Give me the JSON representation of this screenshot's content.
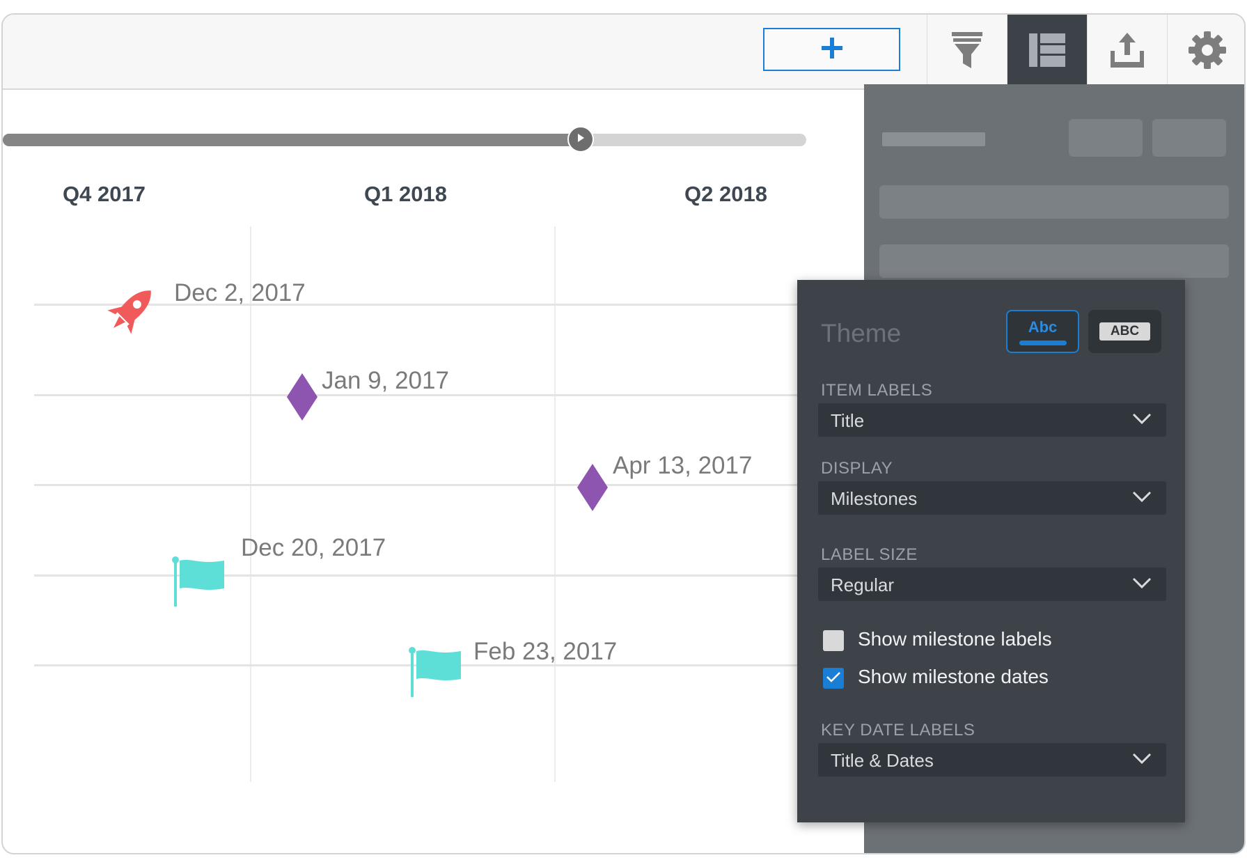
{
  "toolbar": {
    "add_icon": "plus-icon",
    "tools": [
      {
        "name": "filter",
        "icon": "funnel-icon"
      },
      {
        "name": "layout",
        "icon": "layout-icon",
        "active": true
      },
      {
        "name": "export",
        "icon": "upload-icon"
      },
      {
        "name": "settings",
        "icon": "gear-icon"
      }
    ]
  },
  "timeline": {
    "quarters": [
      "Q4 2017",
      "Q1 2018",
      "Q2 2018"
    ],
    "slider_progress": 0.72,
    "milestones": [
      {
        "label": "Dec 2, 2017",
        "icon": "rocket-icon",
        "color": "#f15a5a"
      },
      {
        "label": "Jan 9, 2017",
        "icon": "diamond-icon",
        "color": "#8e55b0"
      },
      {
        "label": "Apr 13, 2017",
        "icon": "diamond-icon",
        "color": "#8e55b0"
      },
      {
        "label": "Dec 20, 2017",
        "icon": "flag-icon",
        "color": "#5ddfd8"
      },
      {
        "label": "Feb 23, 2017",
        "icon": "flag-icon",
        "color": "#5ddfd8"
      }
    ]
  },
  "settings_popup": {
    "theme_title": "Theme",
    "theme_options": [
      "Abc",
      "ABC"
    ],
    "item_labels": {
      "label": "ITEM LABELS",
      "value": "Title"
    },
    "display": {
      "label": "DISPLAY",
      "value": "Milestones"
    },
    "label_size": {
      "label": "LABEL SIZE",
      "value": "Regular"
    },
    "show_milestone_labels": {
      "label": "Show milestone labels",
      "checked": false
    },
    "show_milestone_dates": {
      "label": "Show milestone dates",
      "checked": true
    },
    "key_date_labels": {
      "label": "KEY DATE LABELS",
      "value": "Title & Dates"
    }
  },
  "colors": {
    "accent": "#1a7fd4",
    "panel_dark": "#3d4349",
    "panel_gray": "#6c7175"
  }
}
